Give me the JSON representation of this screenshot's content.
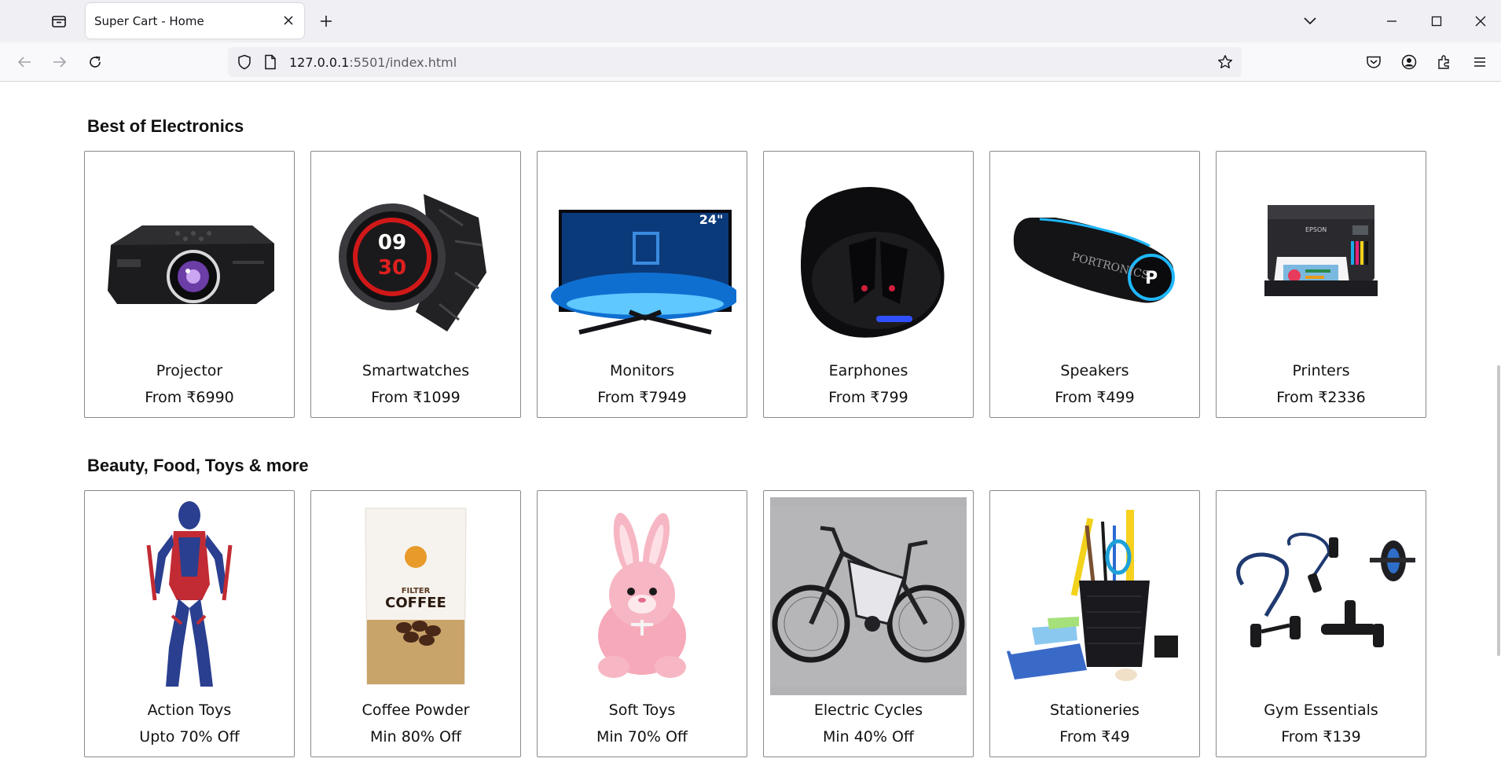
{
  "browser": {
    "tab_title": "Super Cart - Home",
    "url_host": "127.0.0.1",
    "url_rest": ":5501/index.html"
  },
  "sections": [
    {
      "title": "Best of Electronics",
      "items": [
        {
          "name": "Projector",
          "price": "From ₹6990",
          "icon": "projector-image"
        },
        {
          "name": "Smartwatches",
          "price": "From ₹1099",
          "icon": "smartwatch-image"
        },
        {
          "name": "Monitors",
          "price": "From ₹7949",
          "icon": "monitor-image",
          "badge": "24\""
        },
        {
          "name": "Earphones",
          "price": "From ₹799",
          "icon": "earphones-image"
        },
        {
          "name": "Speakers",
          "price": "From ₹499",
          "icon": "speaker-image",
          "brand": "PORTRONICS"
        },
        {
          "name": "Printers",
          "price": "From ₹2336",
          "icon": "printer-image",
          "brand": "EPSON"
        }
      ]
    },
    {
      "title": "Beauty, Food, Toys & more",
      "items": [
        {
          "name": "Action Toys",
          "price": "Upto 70% Off",
          "icon": "action-figure-image"
        },
        {
          "name": "Coffee Powder",
          "price": "Min 80% Off",
          "icon": "coffee-pack-image",
          "label": "FILTER COFFEE"
        },
        {
          "name": "Soft Toys",
          "price": "Min 70% Off",
          "icon": "teddy-bunny-image"
        },
        {
          "name": "Electric Cycles",
          "price": "Min 40% Off",
          "icon": "electric-cycle-image"
        },
        {
          "name": "Stationeries",
          "price": "From ₹49",
          "icon": "stationery-image"
        },
        {
          "name": "Gym Essentials",
          "price": "From ₹139",
          "icon": "gym-kit-image"
        }
      ]
    }
  ]
}
